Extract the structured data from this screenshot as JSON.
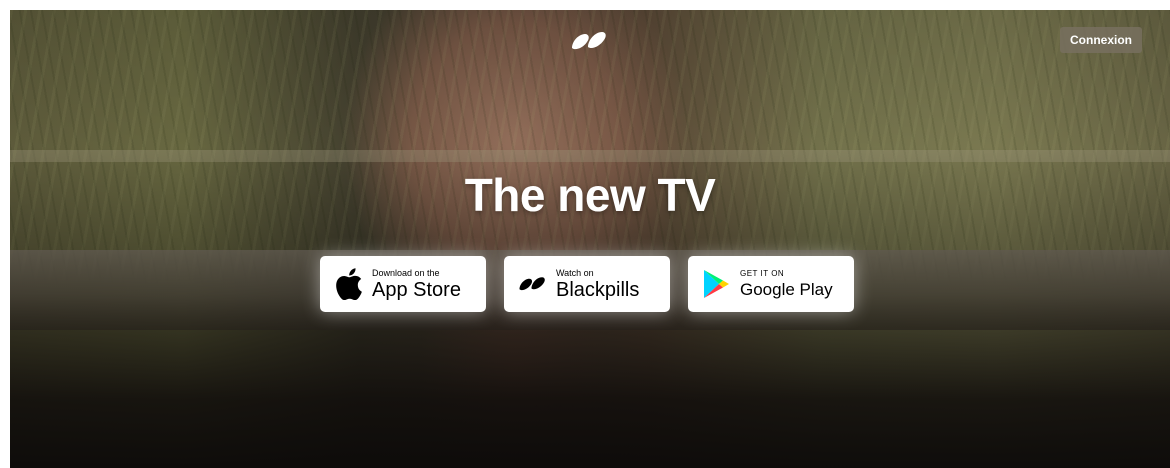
{
  "header": {
    "logo_icon": "blackpills-logo-icon",
    "login_label": "Connexion"
  },
  "hero": {
    "headline": "The new TV"
  },
  "stores": [
    {
      "icon": "apple-icon",
      "small_label": "Download on the",
      "big_label": "App Store"
    },
    {
      "icon": "blackpills-icon",
      "small_label": "Watch on",
      "big_label": "Blackpills"
    },
    {
      "icon": "google-play-icon",
      "small_label": "GET IT ON",
      "big_label": "Google Play"
    }
  ],
  "colors": {
    "headline": "#ffffff",
    "button_bg": "#ffffff",
    "button_text": "#000000",
    "login_bg": "#78705f"
  }
}
